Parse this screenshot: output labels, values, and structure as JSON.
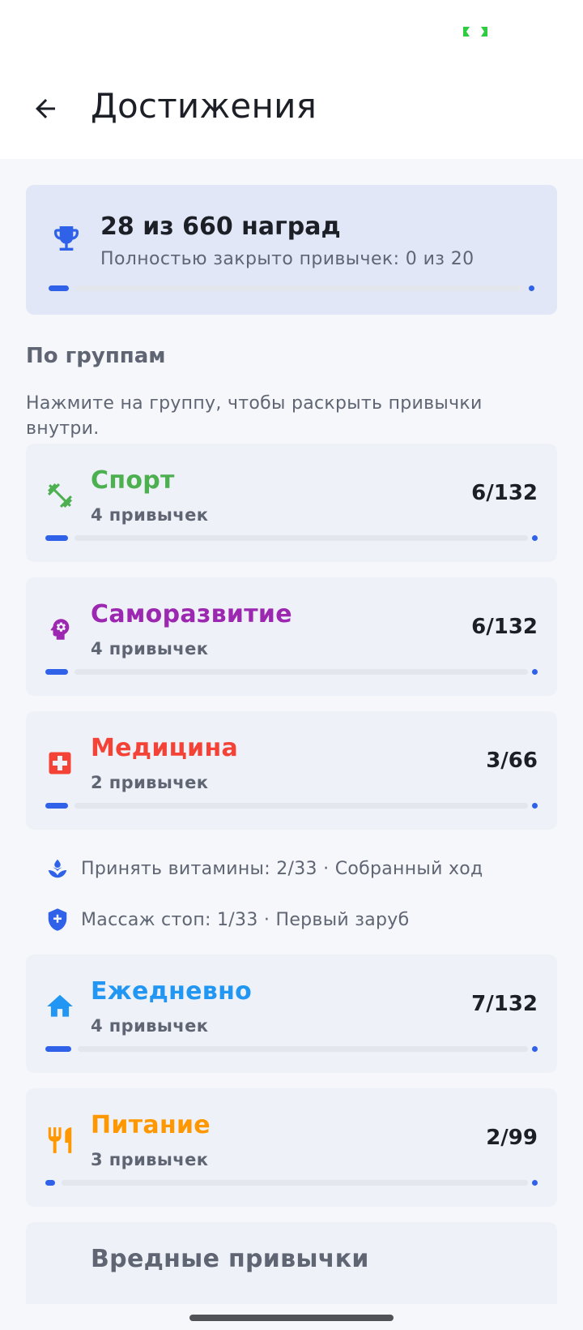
{
  "header": {
    "title": "Достижения"
  },
  "summary": {
    "title": "28 из 660 наград",
    "subtitle": "Полностью закрыто привычек: 0 из 20",
    "progress": 0.0424
  },
  "section": {
    "title": "По группам",
    "hint": "Нажмите на группу, чтобы раскрыть привычки внутри."
  },
  "groups": [
    {
      "name": "Спорт",
      "count": "4 привычек",
      "score": "6/132",
      "progress": 0.0455,
      "color": "#4caf50",
      "icon": "dumbbell-icon"
    },
    {
      "name": "Саморазвитие",
      "count": "4 привычек",
      "score": "6/132",
      "progress": 0.0455,
      "color": "#9c27b0",
      "icon": "head-gear-icon"
    },
    {
      "name": "Медицина",
      "count": "2 привычек",
      "score": "3/66",
      "progress": 0.0455,
      "color": "#f44336",
      "icon": "medical-cross-icon"
    },
    {
      "name": "Ежедневно",
      "count": "4 привычек",
      "score": "7/132",
      "progress": 0.053,
      "color": "#2196f3",
      "icon": "home-icon"
    },
    {
      "name": "Питание",
      "count": "3 привычек",
      "score": "2/99",
      "progress": 0.0202,
      "color": "#ff9800",
      "icon": "fork-knife-icon"
    },
    {
      "name": "Вредные привычки",
      "color": "#5f6573"
    }
  ],
  "medicine_habits": [
    {
      "text": "Принять витамины: 2/33 · Собранный ход",
      "icon": "leaf-drop-icon"
    },
    {
      "text": "Массаж стоп: 1/33 · Первый заруб",
      "icon": "shield-plus-icon"
    }
  ],
  "colors": {
    "accent": "#2f62e8",
    "card": "#eef1f7",
    "summary_card": "#e1e7f6",
    "status": "#2ecc40"
  }
}
